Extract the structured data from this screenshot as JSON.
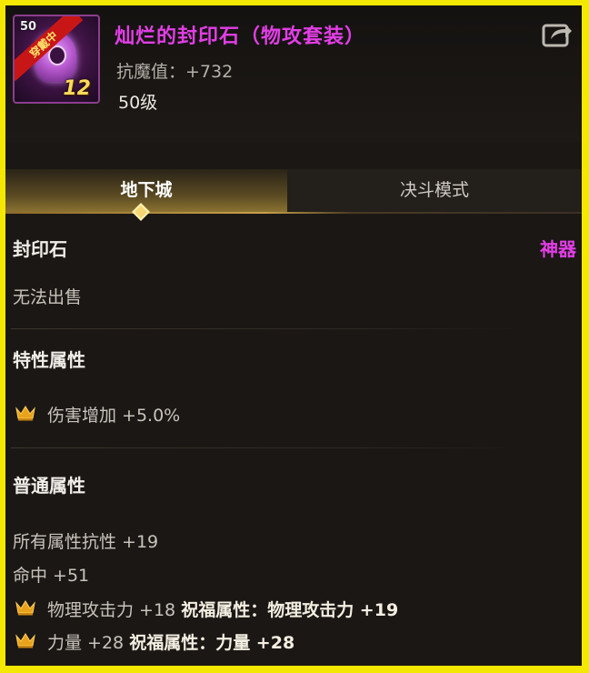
{
  "item": {
    "name": "灿烂的封印石（物攻套装）",
    "icon_level": "50",
    "equipped_badge": "穿戴中",
    "enhance_level": "12",
    "magic_resist": "抗魔值：+732",
    "level": "50级",
    "name_color": "#e23ee6"
  },
  "tabs": [
    {
      "label": "地下城",
      "active": true
    },
    {
      "label": "决斗模式",
      "active": false
    }
  ],
  "details": {
    "type": "封印石",
    "rarity": "神器",
    "rarity_color": "#e33ee8",
    "sell_status": "无法出售",
    "trait_title": "特性属性",
    "trait_stat": "伤害增加 +5.0%",
    "common_title": "普通属性",
    "common_stats": [
      "所有属性抗性 +19",
      "命中 +51"
    ],
    "blessed_stats": [
      {
        "stat": "物理攻击力 +18",
        "bless": "祝福属性：物理攻击力 +19"
      },
      {
        "stat": "力量 +28",
        "bless": "祝福属性：力量 +28"
      }
    ]
  },
  "icons": [
    "share-icon",
    "crown-icon"
  ],
  "colors": {
    "frame": "#f5e800",
    "background": "#1b1714",
    "crown": "#e8a21c"
  }
}
